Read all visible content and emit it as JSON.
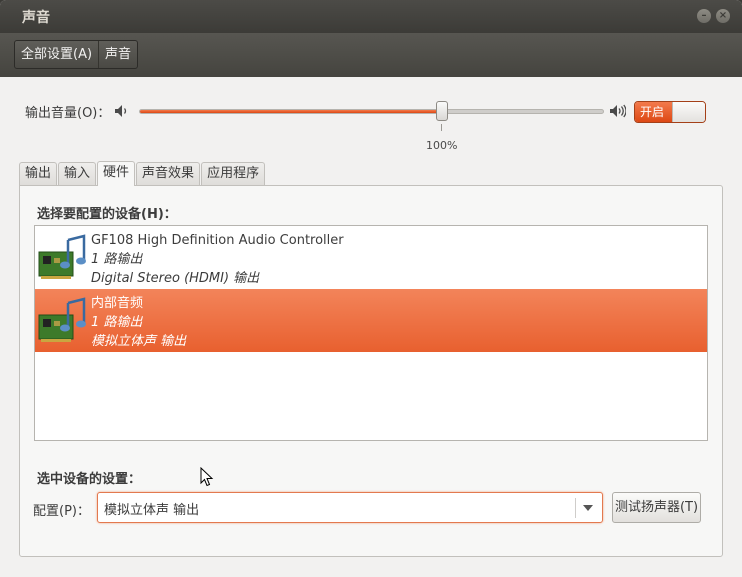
{
  "window": {
    "title": "声音"
  },
  "toolbar": {
    "all_settings": "全部设置(A)",
    "current": "声音"
  },
  "volume": {
    "label": "输出音量(O)：",
    "level_percent": 100,
    "percent_text": "100%",
    "switch_label": "开启",
    "switch_on": true
  },
  "tabs": [
    {
      "label": "输出"
    },
    {
      "label": "输入"
    },
    {
      "label": "硬件",
      "active": true
    },
    {
      "label": "声音效果"
    },
    {
      "label": "应用程序"
    }
  ],
  "hardware": {
    "device_heading": "选择要配置的设备(H)：",
    "devices": [
      {
        "name": "GF108 High Definition Audio Controller",
        "outputs": "1 路输出",
        "profile": "Digital Stereo (HDMI) 输出",
        "selected": false
      },
      {
        "name": "内部音频",
        "outputs": "1 路输出",
        "profile": "模拟立体声 输出",
        "selected": true
      }
    ],
    "settings_heading": "选中设备的设置：",
    "profile_label": "配置(P)：",
    "profile_value": "模拟立体声 输出",
    "test_button": "测试扬声器(T)"
  },
  "colors": {
    "accent": "#dd4814",
    "titlebar": "#3c3b37",
    "background": "#f2f1f0"
  }
}
